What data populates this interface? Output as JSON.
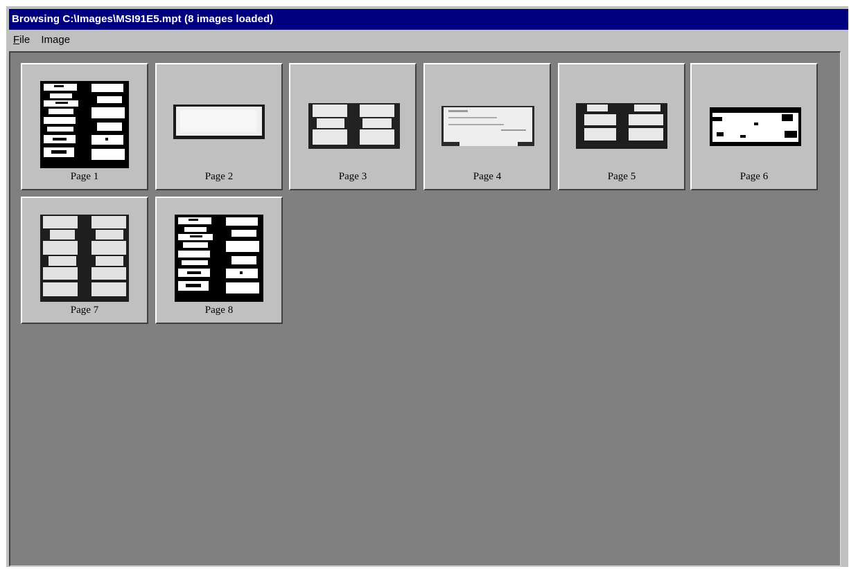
{
  "window": {
    "title": "Browsing C:\\Images\\MSI91E5.mpt (8 images loaded)"
  },
  "menu": {
    "file": {
      "accel": "F",
      "rest": "ile"
    },
    "image": {
      "label": "Image"
    }
  },
  "pages": [
    {
      "label": "Page 1",
      "thumb": "dense-form"
    },
    {
      "label": "Page 2",
      "thumb": "blank-strip"
    },
    {
      "label": "Page 3",
      "thumb": "two-column-slips"
    },
    {
      "label": "Page 4",
      "thumb": "check"
    },
    {
      "label": "Page 5",
      "thumb": "two-column-slips"
    },
    {
      "label": "Page 6",
      "thumb": "envelope"
    },
    {
      "label": "Page 7",
      "thumb": "tall-slips"
    },
    {
      "label": "Page 8",
      "thumb": "dense-form"
    }
  ]
}
